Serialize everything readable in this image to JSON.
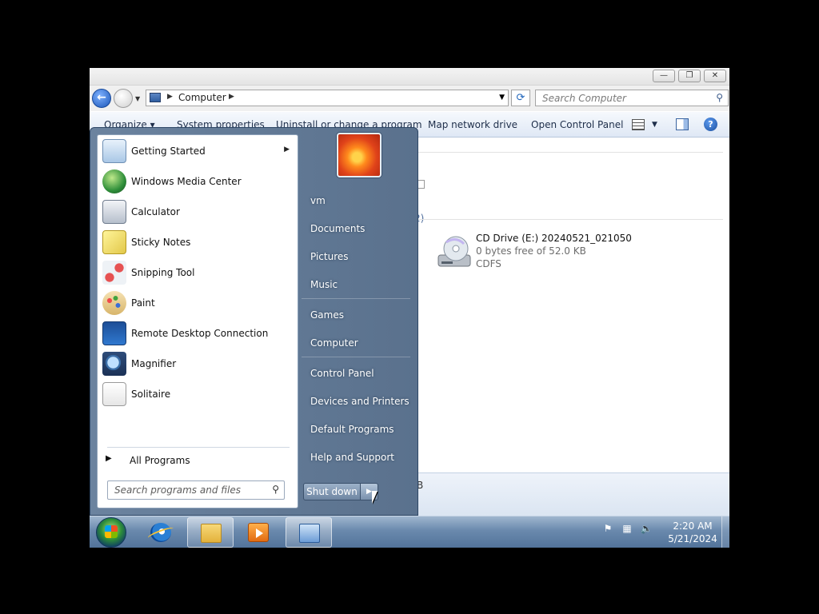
{
  "explorer": {
    "address": {
      "crumb": "Computer"
    },
    "search": {
      "placeholder": "Search Computer"
    },
    "toolbar": {
      "organize": "Organize ▾",
      "system_properties": "System properties",
      "uninstall": "Uninstall or change a program",
      "map_drive": "Map network drive",
      "open_control_panel": "Open Control Panel"
    },
    "group_count_fragment": "2)",
    "drive": {
      "title": "CD Drive (E:) 20240521_021050",
      "free": "0 bytes free of 52.0 KB",
      "filesystem": "CDFS"
    },
    "details_fragment": "B"
  },
  "start_menu": {
    "programs": [
      {
        "label": "Getting Started",
        "icon": "getting-started-icon",
        "has_submenu": true
      },
      {
        "label": "Windows Media Center",
        "icon": "media-center-icon"
      },
      {
        "label": "Calculator",
        "icon": "calculator-icon"
      },
      {
        "label": "Sticky Notes",
        "icon": "sticky-notes-icon"
      },
      {
        "label": "Snipping Tool",
        "icon": "snipping-tool-icon"
      },
      {
        "label": "Paint",
        "icon": "paint-icon"
      },
      {
        "label": "Remote Desktop Connection",
        "icon": "remote-desktop-icon"
      },
      {
        "label": "Magnifier",
        "icon": "magnifier-icon"
      },
      {
        "label": "Solitaire",
        "icon": "solitaire-icon"
      }
    ],
    "all_programs": "All Programs",
    "search_placeholder": "Search programs and files",
    "right_items": [
      "vm",
      "Documents",
      "Pictures",
      "Music",
      "Games",
      "Computer",
      "Control Panel",
      "Devices and Printers",
      "Default Programs",
      "Help and Support"
    ],
    "shutdown": "Shut down"
  },
  "taskbar": {
    "time": "2:20 AM",
    "date": "5/21/2024"
  }
}
